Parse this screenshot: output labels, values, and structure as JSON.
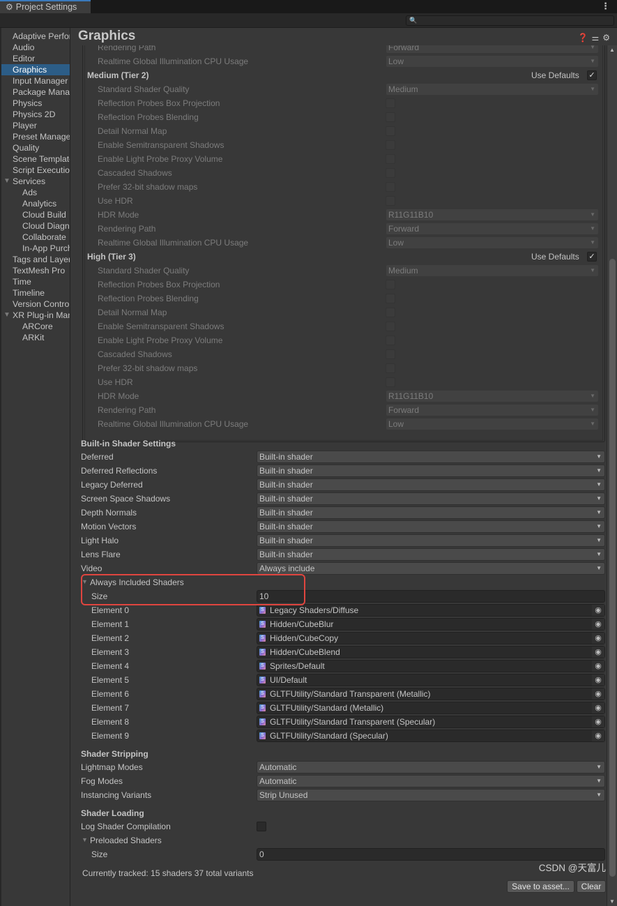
{
  "window": {
    "tab_title": "Project Settings",
    "menu_icon": "⋮",
    "search_placeholder": ""
  },
  "sidebar": {
    "items": [
      {
        "label": "Adaptive Performance",
        "level": 0
      },
      {
        "label": "Audio",
        "level": 0
      },
      {
        "label": "Editor",
        "level": 0
      },
      {
        "label": "Graphics",
        "level": 0,
        "selected": true
      },
      {
        "label": "Input Manager",
        "level": 0
      },
      {
        "label": "Package Manager",
        "level": 0
      },
      {
        "label": "Physics",
        "level": 0
      },
      {
        "label": "Physics 2D",
        "level": 0
      },
      {
        "label": "Player",
        "level": 0
      },
      {
        "label": "Preset Manager",
        "level": 0
      },
      {
        "label": "Quality",
        "level": 0
      },
      {
        "label": "Scene Template",
        "level": 0
      },
      {
        "label": "Script Execution Order",
        "level": 0
      },
      {
        "label": "Services",
        "level": 0,
        "expanded": true
      },
      {
        "label": "Ads",
        "level": 1
      },
      {
        "label": "Analytics",
        "level": 1
      },
      {
        "label": "Cloud Build",
        "level": 1
      },
      {
        "label": "Cloud Diagnostics",
        "level": 1
      },
      {
        "label": "Collaborate",
        "level": 1
      },
      {
        "label": "In-App Purchasing",
        "level": 1
      },
      {
        "label": "Tags and Layers",
        "level": 0
      },
      {
        "label": "TextMesh Pro",
        "level": 0
      },
      {
        "label": "Time",
        "level": 0
      },
      {
        "label": "Timeline",
        "level": 0
      },
      {
        "label": "Version Control",
        "level": 0
      },
      {
        "label": "XR Plug-in Management",
        "level": 0,
        "expanded": true
      },
      {
        "label": "ARCore",
        "level": 1
      },
      {
        "label": "ARKit",
        "level": 1
      }
    ]
  },
  "header": {
    "title": "Graphics"
  },
  "tiers": {
    "top_partial": [
      {
        "label": "Rendering Path",
        "type": "dropdown",
        "value": "Forward"
      },
      {
        "label": "Realtime Global Illumination CPU Usage",
        "type": "dropdown",
        "value": "Low"
      }
    ],
    "medium": {
      "title": "Medium (Tier 2)",
      "use_defaults_label": "Use Defaults",
      "use_defaults": true,
      "rows": [
        {
          "label": "Standard Shader Quality",
          "type": "dropdown",
          "value": "Medium"
        },
        {
          "label": "Reflection Probes Box Projection",
          "type": "checkbox",
          "value": false
        },
        {
          "label": "Reflection Probes Blending",
          "type": "checkbox",
          "value": false
        },
        {
          "label": "Detail Normal Map",
          "type": "checkbox",
          "value": false
        },
        {
          "label": "Enable Semitransparent Shadows",
          "type": "checkbox",
          "value": false
        },
        {
          "label": "Enable Light Probe Proxy Volume",
          "type": "checkbox",
          "value": false
        },
        {
          "label": "Cascaded Shadows",
          "type": "checkbox",
          "value": false
        },
        {
          "label": "Prefer 32-bit shadow maps",
          "type": "checkbox",
          "value": false
        },
        {
          "label": "Use HDR",
          "type": "checkbox",
          "value": false
        },
        {
          "label": "HDR Mode",
          "type": "dropdown",
          "value": "R11G11B10"
        },
        {
          "label": "Rendering Path",
          "type": "dropdown",
          "value": "Forward"
        },
        {
          "label": "Realtime Global Illumination CPU Usage",
          "type": "dropdown",
          "value": "Low"
        }
      ]
    },
    "high": {
      "title": "High (Tier 3)",
      "use_defaults_label": "Use Defaults",
      "use_defaults": true,
      "rows": [
        {
          "label": "Standard Shader Quality",
          "type": "dropdown",
          "value": "Medium"
        },
        {
          "label": "Reflection Probes Box Projection",
          "type": "checkbox",
          "value": false
        },
        {
          "label": "Reflection Probes Blending",
          "type": "checkbox",
          "value": false
        },
        {
          "label": "Detail Normal Map",
          "type": "checkbox",
          "value": false
        },
        {
          "label": "Enable Semitransparent Shadows",
          "type": "checkbox",
          "value": false
        },
        {
          "label": "Enable Light Probe Proxy Volume",
          "type": "checkbox",
          "value": false
        },
        {
          "label": "Cascaded Shadows",
          "type": "checkbox",
          "value": false
        },
        {
          "label": "Prefer 32-bit shadow maps",
          "type": "checkbox",
          "value": false
        },
        {
          "label": "Use HDR",
          "type": "checkbox",
          "value": false
        },
        {
          "label": "HDR Mode",
          "type": "dropdown",
          "value": "R11G11B10"
        },
        {
          "label": "Rendering Path",
          "type": "dropdown",
          "value": "Forward"
        },
        {
          "label": "Realtime Global Illumination CPU Usage",
          "type": "dropdown",
          "value": "Low"
        }
      ]
    }
  },
  "builtin": {
    "title": "Built-in Shader Settings",
    "rows": [
      {
        "label": "Deferred",
        "value": "Built-in shader"
      },
      {
        "label": "Deferred Reflections",
        "value": "Built-in shader"
      },
      {
        "label": "Legacy Deferred",
        "value": "Built-in shader"
      },
      {
        "label": "Screen Space Shadows",
        "value": "Built-in shader"
      },
      {
        "label": "Depth Normals",
        "value": "Built-in shader"
      },
      {
        "label": "Motion Vectors",
        "value": "Built-in shader"
      },
      {
        "label": "Light Halo",
        "value": "Built-in shader"
      },
      {
        "label": "Lens Flare",
        "value": "Built-in shader"
      },
      {
        "label": "Video",
        "value": "Always include"
      }
    ]
  },
  "always_included": {
    "title": "Always Included Shaders",
    "size_label": "Size",
    "size": "10",
    "elements": [
      {
        "label": "Element 0",
        "value": "Legacy Shaders/Diffuse"
      },
      {
        "label": "Element 1",
        "value": "Hidden/CubeBlur"
      },
      {
        "label": "Element 2",
        "value": "Hidden/CubeCopy"
      },
      {
        "label": "Element 3",
        "value": "Hidden/CubeBlend"
      },
      {
        "label": "Element 4",
        "value": "Sprites/Default"
      },
      {
        "label": "Element 5",
        "value": "UI/Default"
      },
      {
        "label": "Element 6",
        "value": "GLTFUtility/Standard Transparent (Metallic)"
      },
      {
        "label": "Element 7",
        "value": "GLTFUtility/Standard (Metallic)"
      },
      {
        "label": "Element 8",
        "value": "GLTFUtility/Standard Transparent (Specular)"
      },
      {
        "label": "Element 9",
        "value": "GLTFUtility/Standard (Specular)"
      }
    ]
  },
  "stripping": {
    "title": "Shader Stripping",
    "rows": [
      {
        "label": "Lightmap Modes",
        "value": "Automatic"
      },
      {
        "label": "Fog Modes",
        "value": "Automatic"
      },
      {
        "label": "Instancing Variants",
        "value": "Strip Unused"
      }
    ]
  },
  "loading": {
    "title": "Shader Loading",
    "log_label": "Log Shader Compilation",
    "log_value": false,
    "preloaded_title": "Preloaded Shaders",
    "size_label": "Size",
    "size": "0",
    "tracked": "Currently tracked: 15 shaders 37 total variants",
    "save_button": "Save to asset...",
    "clear_button": "Clear"
  },
  "highlight_color": "#e0453f",
  "selection_color": "#2c5d87",
  "watermark": "CSDN @天富儿"
}
